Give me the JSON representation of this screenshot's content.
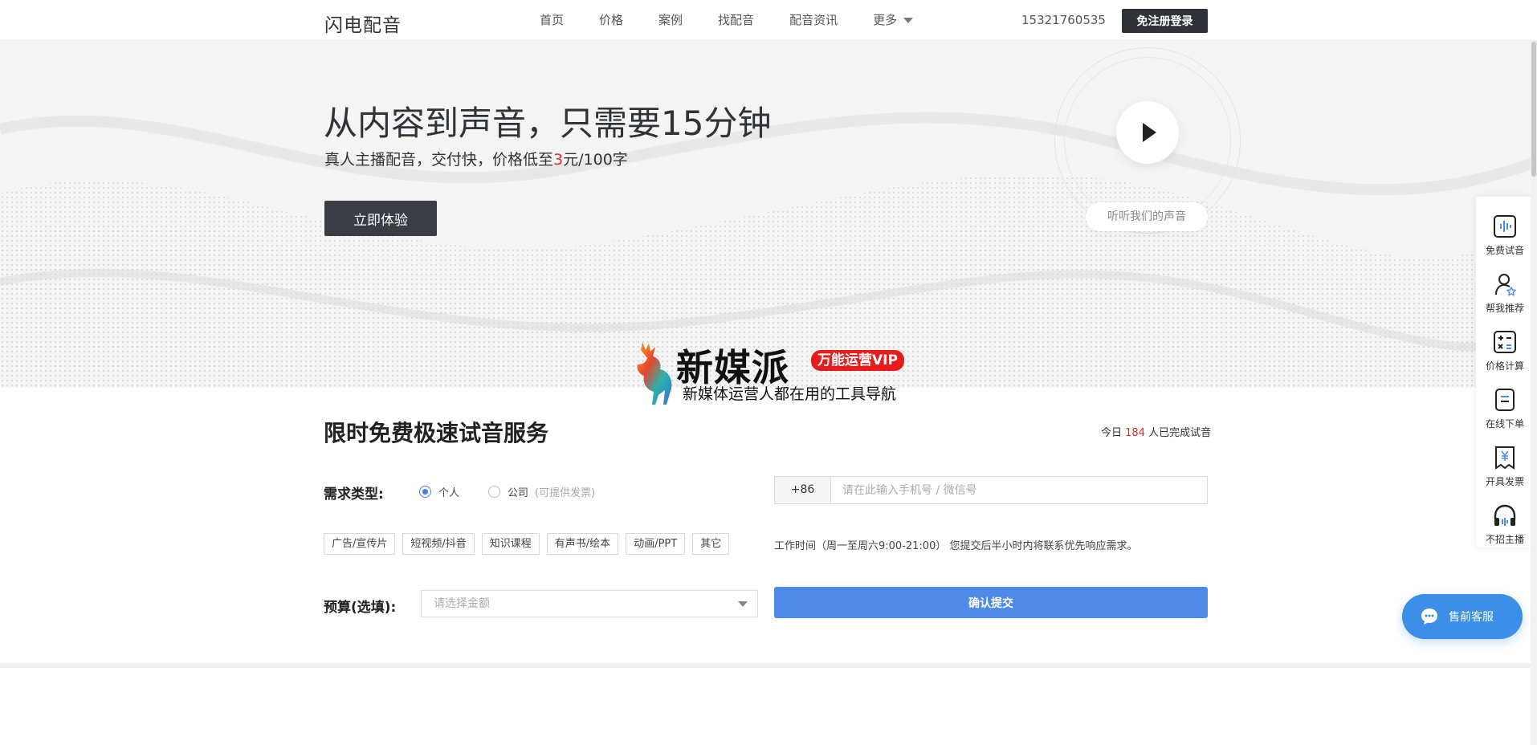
{
  "nav": {
    "logo": "闪电配音",
    "links": [
      "首页",
      "价格",
      "案例",
      "找配音",
      "配音资讯"
    ],
    "more_label": "更多",
    "phone": "15321760535",
    "login_label": "免注册登录"
  },
  "hero": {
    "title": "从内容到声音，只需要15分钟",
    "subtitle_before": "真人主播配音，交付快，价格低至",
    "subtitle_price": "3",
    "subtitle_after": "元/100字",
    "cta_label": "立即体验",
    "listen_label": "听听我们的声音"
  },
  "banner": {
    "title": "新媒派",
    "vip": "万能运营VIP",
    "tagline": "新媒体运营人都在用的工具导航"
  },
  "form": {
    "section_title": "限时免费极速试音服务",
    "today_before": "今日",
    "today_count": "184",
    "today_after": "人已完成试音",
    "type_label": "需求类型:",
    "radio_personal": "个人",
    "radio_company": "公司",
    "radio_company_hint": "(可提供发票)",
    "country_code": "+86",
    "phone_placeholder": "请在此输入手机号 / 微信号",
    "tags": [
      "广告/宣传片",
      "短视频/抖音",
      "知识课程",
      "有声书/绘本",
      "动画/PPT",
      "其它"
    ],
    "work_time": "工作时间（周一至周六9:00-21:00） 您提交后半小时内将联系优先响应需求。",
    "budget_label": "预算(选填):",
    "budget_placeholder": "请选择金额",
    "submit_label": "确认提交"
  },
  "side_bar": {
    "items": [
      {
        "label": "免费试音",
        "icon": "waveform-icon"
      },
      {
        "label": "帮我推荐",
        "icon": "user-star-icon"
      },
      {
        "label": "价格计算",
        "icon": "calculator-icon"
      },
      {
        "label": "在线下单",
        "icon": "document-icon"
      },
      {
        "label": "开具发票",
        "icon": "invoice-icon"
      },
      {
        "label": "不招主播",
        "icon": "headphones-icon"
      }
    ]
  },
  "chat": {
    "label": "售前客服"
  },
  "colors": {
    "accent_blue": "#4e8be8",
    "price_red": "#e0262b",
    "dark_button": "#2f3338"
  }
}
